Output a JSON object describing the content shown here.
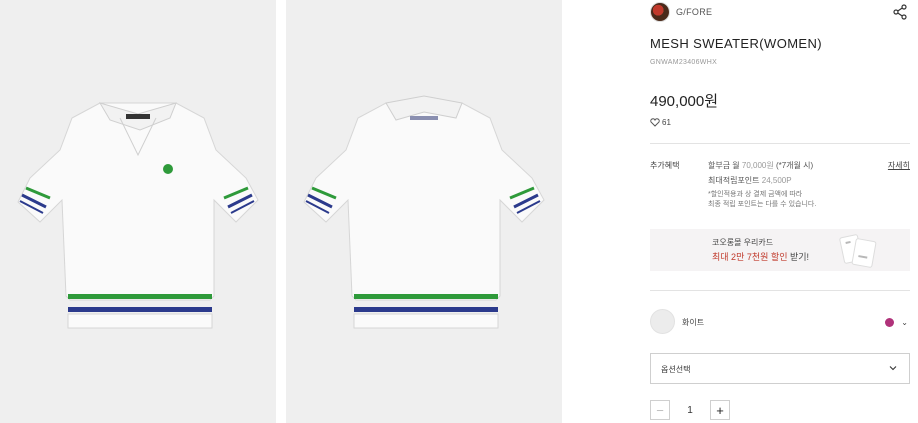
{
  "product": {
    "brand": "G/FORE",
    "title": "MESH SWEATER(WOMEN)",
    "sku": "GNWAM23406WHX",
    "price": "490,000원",
    "likes": "61"
  },
  "benefits": {
    "label": "추가혜택",
    "line1_prefix": "할부금 월 ",
    "line1_amount": "70,000원",
    "line1_suffix": " (*7개월 시)",
    "line2_prefix": "최대적립포인트 ",
    "line2_amount": "24,500P",
    "detail_link": "자세히",
    "note_line1": "*할인적용과 상 결제 금액에 따라",
    "note_line2": "최종 적립 포인트는 다를 수 있습니다."
  },
  "card_banner": {
    "line1": "코오롱몰 우리카드",
    "line2_highlight": "최대 2만 7천원 할인",
    "line2_rest": " 받기!"
  },
  "option": {
    "color_name": "화이트",
    "select_placeholder": "옵션선택"
  },
  "quantity": {
    "value": "1",
    "minus": "−",
    "plus": "+"
  },
  "colors": {
    "background_left": "#efefef",
    "sweater": "#fafafa",
    "stripe_green": "#2e9a3a",
    "stripe_navy": "#2b3a8c",
    "selected_color_dot": "#b0327a",
    "promo_red": "#c0392b"
  }
}
